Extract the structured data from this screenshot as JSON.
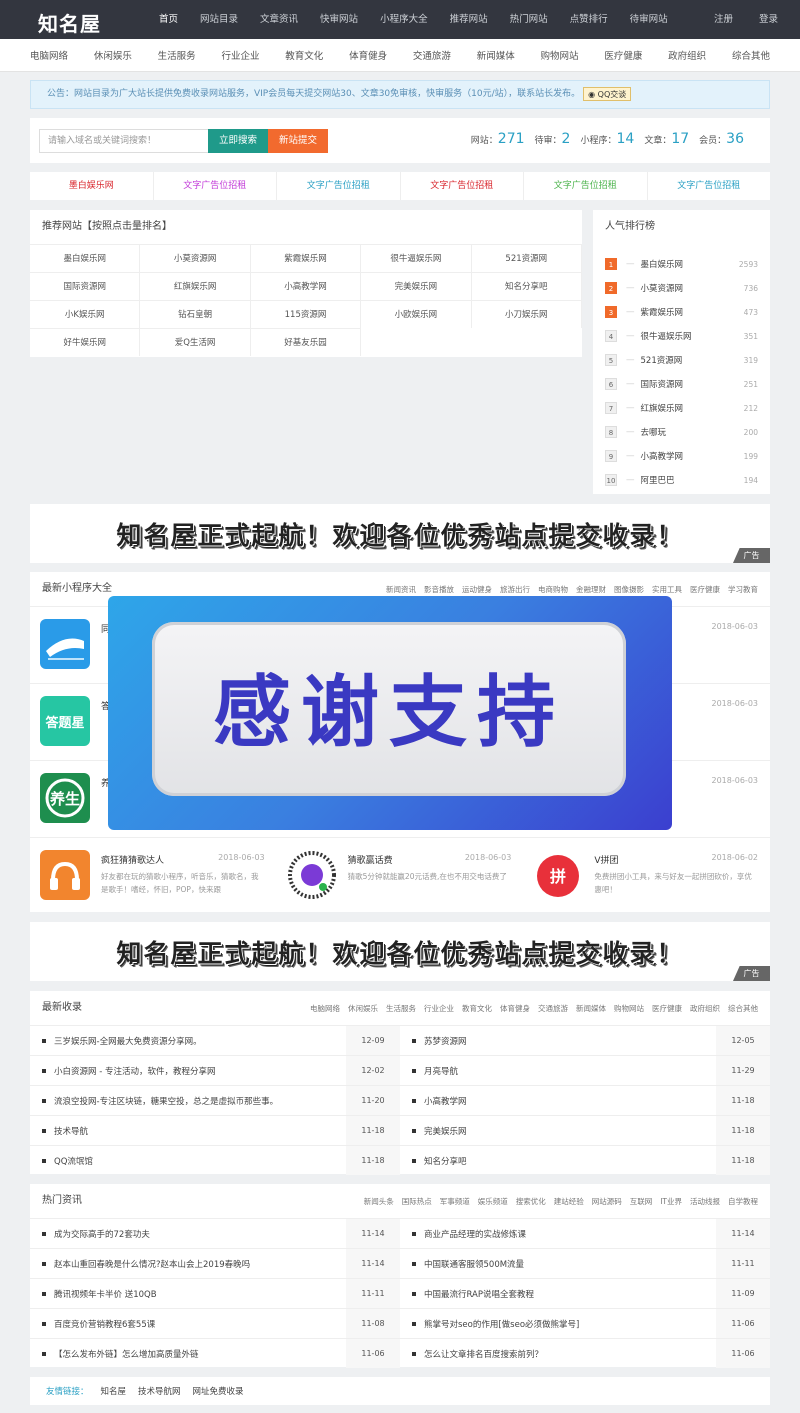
{
  "logo": "知名屋",
  "nav": [
    "首页",
    "网站目录",
    "文章资讯",
    "快审网站",
    "小程序大全",
    "推荐网站",
    "热门网站",
    "点赞排行",
    "待审网站"
  ],
  "auth": {
    "register": "注册",
    "login": "登录"
  },
  "categories": [
    "电脑网络",
    "休闲娱乐",
    "生活服务",
    "行业企业",
    "教育文化",
    "体育健身",
    "交通旅游",
    "新闻媒体",
    "购物网站",
    "医疗健康",
    "政府组织",
    "综合其他"
  ],
  "notice": {
    "text": "公告：网站目录为广大站长提供免费收录网站服务，VIP会员每天提交网站30、文章30免审核，快审服务（10元/站），联系站长发布。",
    "qq": "QQ交谈"
  },
  "search": {
    "placeholder": "请输入域名或关键词搜索！",
    "search_btn": "立即搜索",
    "submit_btn": "新站提交"
  },
  "stats": [
    {
      "label": "网站：",
      "value": "271"
    },
    {
      "label": "待审：",
      "value": "2"
    },
    {
      "label": "小程序：",
      "value": "14"
    },
    {
      "label": "文章：",
      "value": "17"
    },
    {
      "label": "会员：",
      "value": "36"
    }
  ],
  "ad_links": [
    {
      "text": "墨白娱乐网",
      "color": "#d9272e"
    },
    {
      "text": "文字广告位招租",
      "color": "#c23ad8"
    },
    {
      "text": "文字广告位招租",
      "color": "#2aa0c4"
    },
    {
      "text": "文字广告位招租",
      "color": "#d9272e"
    },
    {
      "text": "文字广告位招租",
      "color": "#4bb34b"
    },
    {
      "text": "文字广告位招租",
      "color": "#2aa0c4"
    }
  ],
  "recommended": {
    "title": "推荐网站【按照点击量排名】",
    "items": [
      "墨白娱乐网",
      "小莫资源网",
      "紫霞娱乐网",
      "很牛逼娱乐网",
      "521资源网",
      "国际资源网",
      "红旗娱乐网",
      "小高教学网",
      "完美娱乐网",
      "知名分享吧",
      "小K娱乐网",
      "钻石皇朝",
      "115资源网",
      "小欧娱乐网",
      "小刀娱乐网",
      "好牛娱乐网",
      "爱Q生活网",
      "好基友乐园"
    ]
  },
  "ranking": {
    "title": "人气排行榜",
    "items": [
      {
        "rank": "1",
        "name": "墨白娱乐网",
        "count": "2593"
      },
      {
        "rank": "2",
        "name": "小莫资源网",
        "count": "736"
      },
      {
        "rank": "3",
        "name": "紫霞娱乐网",
        "count": "473"
      },
      {
        "rank": "4",
        "name": "很牛逼娱乐网",
        "count": "351"
      },
      {
        "rank": "5",
        "name": "521资源网",
        "count": "319"
      },
      {
        "rank": "6",
        "name": "国际资源网",
        "count": "251"
      },
      {
        "rank": "7",
        "name": "红旗娱乐网",
        "count": "212"
      },
      {
        "rank": "8",
        "name": "去哪玩",
        "count": "200"
      },
      {
        "rank": "9",
        "name": "小高教学网",
        "count": "199"
      },
      {
        "rank": "10",
        "name": "阿里巴巴",
        "count": "194"
      }
    ]
  },
  "banner": {
    "text": "知名屋正式起航！欢迎各位优秀站点提交收录！",
    "tag": "广告"
  },
  "mini_programs": {
    "title": "最新小程序大全",
    "tabs": [
      "新闻资讯",
      "影音播放",
      "运动健身",
      "旅游出行",
      "电商购物",
      "金融理财",
      "图像摄影",
      "实用工具",
      "医疗健康",
      "学习教育"
    ],
    "items": [
      {
        "name": "同",
        "date": "",
        "desc": "",
        "icon": "train"
      },
      {
        "name": "",
        "date": "",
        "desc": "",
        "icon": "none"
      },
      {
        "name": "",
        "date": "2018-06-03",
        "desc": "",
        "icon": "none"
      },
      {
        "name": "答",
        "date": "",
        "desc": "",
        "icon": "answer"
      },
      {
        "name": "",
        "date": "",
        "desc": "",
        "icon": "none"
      },
      {
        "name": "",
        "date": "2018-06-03",
        "desc": "",
        "icon": "none"
      },
      {
        "name": "养",
        "date": "",
        "desc": "",
        "icon": "health"
      },
      {
        "name": "",
        "date": "",
        "desc": "",
        "icon": "none"
      },
      {
        "name": "",
        "date": "2018-06-03",
        "desc": "",
        "icon": "none"
      },
      {
        "name": "疯狂猜猜歌达人",
        "date": "2018-06-03",
        "desc": "好友都在玩的猜歌小程序，听音乐，猜歌名，我是歌手！嗜经，怀旧，POP，快来跟",
        "icon": "music"
      },
      {
        "name": "猜歌赢话费",
        "date": "2018-06-03",
        "desc": "猜歌5分钟就能赢20元话费,在也不用交电话费了",
        "icon": "qr"
      },
      {
        "name": "V拼团",
        "date": "2018-06-02",
        "desc": "免费拼团小工具，来与好友一起拼团砍价，享优惠吧！",
        "icon": "pin"
      }
    ]
  },
  "overlay": {
    "text": "感谢支持"
  },
  "latest": {
    "title": "最新收录",
    "tabs": [
      "电脑网络",
      "休闲娱乐",
      "生活服务",
      "行业企业",
      "教育文化",
      "体育健身",
      "交通旅游",
      "新闻媒体",
      "购物网站",
      "医疗健康",
      "政府组织",
      "综合其他"
    ],
    "rows": [
      [
        {
          "title": "三岁娱乐网-全网最大免费资源分享网。",
          "date": "12-09"
        },
        {
          "title": "苏梦资源网",
          "date": "12-05"
        }
      ],
      [
        {
          "title": "小白资源网 - 专注活动，软件，教程分享网",
          "date": "12-02"
        },
        {
          "title": "月亮导航",
          "date": "11-29"
        }
      ],
      [
        {
          "title": "流浪空投网-专注区块链，糖果空投，总之是虚拟币那些事。",
          "date": "11-20"
        },
        {
          "title": "小高教学网",
          "date": "11-18"
        }
      ],
      [
        {
          "title": "技术导航",
          "date": "11-18"
        },
        {
          "title": "完美娱乐网",
          "date": "11-18"
        }
      ],
      [
        {
          "title": "QQ流氓馆",
          "date": "11-18"
        },
        {
          "title": "知名分享吧",
          "date": "11-18"
        }
      ]
    ]
  },
  "hot": {
    "title": "热门资讯",
    "tabs": [
      "新闻头条",
      "国际热点",
      "军事频道",
      "娱乐频道",
      "搜索优化",
      "建站经验",
      "网站源码",
      "互联网",
      "IT业界",
      "活动线报",
      "自学教程"
    ],
    "rows": [
      [
        {
          "title": "成为交际高手的72套功夫",
          "date": "11-14"
        },
        {
          "title": "商业产品经理的实战修炼课",
          "date": "11-14"
        }
      ],
      [
        {
          "title": "赵本山重回春晚是什么情况?赵本山会上2019春晚吗",
          "date": "11-14"
        },
        {
          "title": "中国联通客服领500M流量",
          "date": "11-11"
        }
      ],
      [
        {
          "title": "腾讯视频年卡半价 送10QB",
          "date": "11-11"
        },
        {
          "title": "中国最流行RAP说唱全套教程",
          "date": "11-09"
        }
      ],
      [
        {
          "title": "百度竞价营销教程6套55课",
          "date": "11-08"
        },
        {
          "title": "熊掌号对seo的作用[做seo必须做熊掌号]",
          "date": "11-06"
        }
      ],
      [
        {
          "title": "【怎么发布外链】怎么增加高质量外链",
          "date": "11-06"
        },
        {
          "title": "怎么让文章排名百度搜索前列？",
          "date": "11-06"
        }
      ]
    ]
  },
  "friends": {
    "label": "友情链接：",
    "links": [
      "知名屋",
      "技术导航网",
      "网址免费收录"
    ]
  },
  "colors": {
    "nav_bg": "#33363f",
    "accent": "#2aa0c4",
    "search_btn": "#1f9a8a",
    "submit_btn": "#f26a2e",
    "hot_rank": "#f06a2a"
  }
}
